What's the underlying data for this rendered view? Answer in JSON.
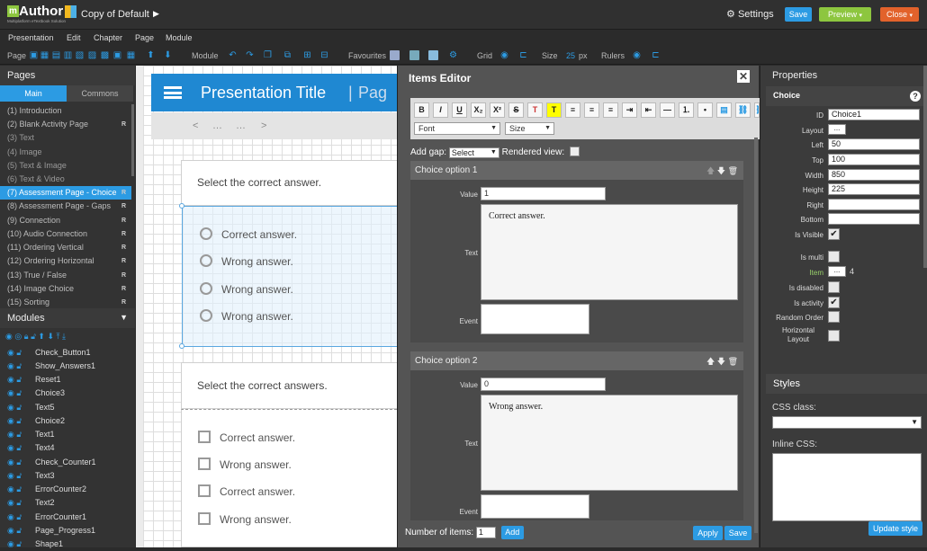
{
  "app": {
    "logo_name": "Author",
    "logo_letter": "m",
    "logo_tagline": "Multiplatform eTextbook Solution",
    "doc_title": "Copy of Default",
    "settings_label": "Settings",
    "save_label": "Save",
    "preview_label": "Preview",
    "close_label": "Close"
  },
  "menu": [
    "Presentation",
    "Edit",
    "Chapter",
    "Page",
    "Module"
  ],
  "toolbar": {
    "page_label": "Page",
    "module_label": "Module",
    "favourites_label": "Favourites",
    "grid_label": "Grid",
    "size_label": "Size",
    "size_value": "25",
    "size_unit": "px",
    "rulers_label": "Rulers"
  },
  "left": {
    "pages_title": "Pages",
    "tab_main": "Main",
    "tab_commons": "Commons",
    "modules_title": "Modules",
    "pages": [
      {
        "label": "(1) Introduction",
        "r": ""
      },
      {
        "label": "(2) Blank Activity Page",
        "r": "R"
      },
      {
        "label": "(3) Text",
        "r": ""
      },
      {
        "label": "(4) Image",
        "r": ""
      },
      {
        "label": "(5) Text & Image",
        "r": ""
      },
      {
        "label": "(6) Text & Video",
        "r": ""
      },
      {
        "label": "(7) Assessment Page - Choice",
        "r": "R"
      },
      {
        "label": "(8) Assessment Page - Gaps",
        "r": "R"
      },
      {
        "label": "(9) Connection",
        "r": "R"
      },
      {
        "label": "(10) Audio Connection",
        "r": "R"
      },
      {
        "label": "(11) Ordering Vertical",
        "r": "R"
      },
      {
        "label": "(12) Ordering Horizontal",
        "r": "R"
      },
      {
        "label": "(13) True / False",
        "r": "R"
      },
      {
        "label": "(14) Image Choice",
        "r": "R"
      },
      {
        "label": "(15) Sorting",
        "r": "R"
      }
    ],
    "modules": [
      "Check_Button1",
      "Show_Answers1",
      "Reset1",
      "Choice3",
      "Text5",
      "Choice2",
      "Text1",
      "Text4",
      "Check_Counter1",
      "Text3",
      "ErrorCounter2",
      "Text2",
      "ErrorCounter1",
      "Page_Progress1",
      "Shape1"
    ]
  },
  "canvas": {
    "presentation_title": "Presentation Title",
    "page_word": "Pag",
    "nav_prev": "<",
    "nav_dots1": "…",
    "nav_dots2": "…",
    "nav_next": ">",
    "q1": "Select the correct answer.",
    "q1_options": [
      "Correct answer.",
      "Wrong answer.",
      "Wrong answer.",
      "Wrong answer."
    ],
    "q2": "Select the correct answers.",
    "q2_options": [
      "Correct answer.",
      "Wrong answer.",
      "Correct answer.",
      "Wrong answer."
    ]
  },
  "editor": {
    "title": "Items Editor",
    "close": "✕",
    "font_label": "Font",
    "size_label": "Size",
    "add_gap_label": "Add gap:",
    "add_gap_value": "Select",
    "rendered_view_label": "Rendered view:",
    "options": [
      {
        "title": "Choice option 1",
        "value": "1",
        "text": "Correct answer."
      },
      {
        "title": "Choice option 2",
        "value": "0",
        "text": "Wrong answer."
      }
    ],
    "value_label": "Value",
    "text_label": "Text",
    "event_label": "Event",
    "number_label": "Number of items:",
    "number_value": "1",
    "add_label": "Add",
    "apply_label": "Apply",
    "save_label": "Save",
    "rte_buttons": [
      "B",
      "I",
      "U",
      "X₂",
      "X²",
      "S",
      "T",
      "T",
      "≡",
      "≡",
      "≡",
      "⇥",
      "⇤",
      "—",
      "⒈",
      "•",
      "▤",
      "⛓",
      "⛓"
    ]
  },
  "props": {
    "title": "Properties",
    "section": "Choice",
    "help": "?",
    "id_label": "ID",
    "id_value": "Choice1",
    "layout_label": "Layout",
    "left_label": "Left",
    "left_value": "50",
    "top_label": "Top",
    "top_value": "100",
    "width_label": "Width",
    "width_value": "850",
    "height_label": "Height",
    "height_value": "225",
    "right_label": "Right",
    "bottom_label": "Bottom",
    "visible_label": "Is Visible",
    "multi_label": "Is multi",
    "item_label": "Item",
    "item_count": "4",
    "disabled_label": "Is disabled",
    "activity_label": "Is activity",
    "random_label": "Random Order",
    "horizontal_label": "Horizontal Layout",
    "styles_title": "Styles",
    "css_class_label": "CSS class:",
    "inline_css_label": "Inline CSS:",
    "update_label": "Update style",
    "dots": "..."
  },
  "colors": {
    "accent": "#2c9be3",
    "preview": "#8dc63f",
    "close": "#e2622b",
    "header": "#1f88d2"
  }
}
